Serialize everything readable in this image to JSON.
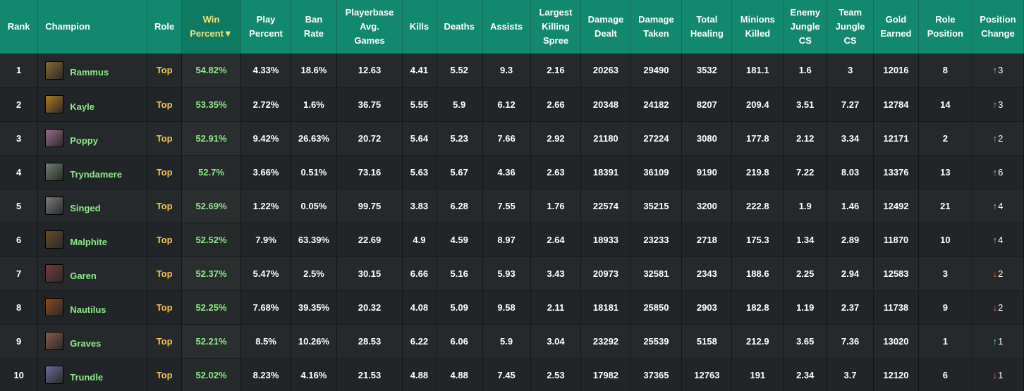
{
  "colors": {
    "header_bg": "#12896e",
    "sorted_header_text": "#f6e27a",
    "champion_text": "#8fe88a",
    "role_text": "#f6c453",
    "up_arrow": "#5fe07b",
    "down_arrow": "#ff6a3d"
  },
  "headers": [
    [
      "Rank"
    ],
    [
      "Champion"
    ],
    [
      "Role"
    ],
    [
      "Win",
      "Percent▼"
    ],
    [
      "Play",
      "Percent"
    ],
    [
      "Ban",
      "Rate"
    ],
    [
      "Playerbase",
      "Avg.",
      "Games"
    ],
    [
      "Kills"
    ],
    [
      "Deaths"
    ],
    [
      "Assists"
    ],
    [
      "Largest",
      "Killing",
      "Spree"
    ],
    [
      "Damage",
      "Dealt"
    ],
    [
      "Damage",
      "Taken"
    ],
    [
      "Total",
      "Healing"
    ],
    [
      "Minions",
      "Killed"
    ],
    [
      "Enemy",
      "Jungle",
      "CS"
    ],
    [
      "Team",
      "Jungle",
      "CS"
    ],
    [
      "Gold",
      "Earned"
    ],
    [
      "Role",
      "Position"
    ],
    [
      "Position",
      "Change"
    ]
  ],
  "rows": [
    {
      "rank": "1",
      "champion": "Rammus",
      "role": "Top",
      "win": "54.82%",
      "play": "4.33%",
      "ban": "18.6%",
      "games": "12.63",
      "kills": "4.41",
      "deaths": "5.52",
      "assists": "9.3",
      "spree": "2.16",
      "dealt": "20263",
      "taken": "29490",
      "healing": "3532",
      "minions": "181.1",
      "enemy_cs": "1.6",
      "team_cs": "3",
      "gold": "12016",
      "role_pos": "8",
      "change_dir": "up",
      "change": "3"
    },
    {
      "rank": "2",
      "champion": "Kayle",
      "role": "Top",
      "win": "53.35%",
      "play": "2.72%",
      "ban": "1.6%",
      "games": "36.75",
      "kills": "5.55",
      "deaths": "5.9",
      "assists": "6.12",
      "spree": "2.66",
      "dealt": "20348",
      "taken": "24182",
      "healing": "8207",
      "minions": "209.4",
      "enemy_cs": "3.51",
      "team_cs": "7.27",
      "gold": "12784",
      "role_pos": "14",
      "change_dir": "up",
      "change": "3"
    },
    {
      "rank": "3",
      "champion": "Poppy",
      "role": "Top",
      "win": "52.91%",
      "play": "9.42%",
      "ban": "26.63%",
      "games": "20.72",
      "kills": "5.64",
      "deaths": "5.23",
      "assists": "7.66",
      "spree": "2.92",
      "dealt": "21180",
      "taken": "27224",
      "healing": "3080",
      "minions": "177.8",
      "enemy_cs": "2.12",
      "team_cs": "3.34",
      "gold": "12171",
      "role_pos": "2",
      "change_dir": "up",
      "change": "2"
    },
    {
      "rank": "4",
      "champion": "Tryndamere",
      "role": "Top",
      "win": "52.7%",
      "play": "3.66%",
      "ban": "0.51%",
      "games": "73.16",
      "kills": "5.63",
      "deaths": "5.67",
      "assists": "4.36",
      "spree": "2.63",
      "dealt": "18391",
      "taken": "36109",
      "healing": "9190",
      "minions": "219.8",
      "enemy_cs": "7.22",
      "team_cs": "8.03",
      "gold": "13376",
      "role_pos": "13",
      "change_dir": "up",
      "change": "6"
    },
    {
      "rank": "5",
      "champion": "Singed",
      "role": "Top",
      "win": "52.69%",
      "play": "1.22%",
      "ban": "0.05%",
      "games": "99.75",
      "kills": "3.83",
      "deaths": "6.28",
      "assists": "7.55",
      "spree": "1.76",
      "dealt": "22574",
      "taken": "35215",
      "healing": "3200",
      "minions": "222.8",
      "enemy_cs": "1.9",
      "team_cs": "1.46",
      "gold": "12492",
      "role_pos": "21",
      "change_dir": "up",
      "change": "4"
    },
    {
      "rank": "6",
      "champion": "Malphite",
      "role": "Top",
      "win": "52.52%",
      "play": "7.9%",
      "ban": "63.39%",
      "games": "22.69",
      "kills": "4.9",
      "deaths": "4.59",
      "assists": "8.97",
      "spree": "2.64",
      "dealt": "18933",
      "taken": "23233",
      "healing": "2718",
      "minions": "175.3",
      "enemy_cs": "1.34",
      "team_cs": "2.89",
      "gold": "11870",
      "role_pos": "10",
      "change_dir": "up",
      "change": "4"
    },
    {
      "rank": "7",
      "champion": "Garen",
      "role": "Top",
      "win": "52.37%",
      "play": "5.47%",
      "ban": "2.5%",
      "games": "30.15",
      "kills": "6.66",
      "deaths": "5.16",
      "assists": "5.93",
      "spree": "3.43",
      "dealt": "20973",
      "taken": "32581",
      "healing": "2343",
      "minions": "188.6",
      "enemy_cs": "2.25",
      "team_cs": "2.94",
      "gold": "12583",
      "role_pos": "3",
      "change_dir": "down",
      "change": "2"
    },
    {
      "rank": "8",
      "champion": "Nautilus",
      "role": "Top",
      "win": "52.25%",
      "play": "7.68%",
      "ban": "39.35%",
      "games": "20.32",
      "kills": "4.08",
      "deaths": "5.09",
      "assists": "9.58",
      "spree": "2.11",
      "dealt": "18181",
      "taken": "25850",
      "healing": "2903",
      "minions": "182.8",
      "enemy_cs": "1.19",
      "team_cs": "2.37",
      "gold": "11738",
      "role_pos": "9",
      "change_dir": "down",
      "change": "2"
    },
    {
      "rank": "9",
      "champion": "Graves",
      "role": "Top",
      "win": "52.21%",
      "play": "8.5%",
      "ban": "10.26%",
      "games": "28.53",
      "kills": "6.22",
      "deaths": "6.06",
      "assists": "5.9",
      "spree": "3.04",
      "dealt": "23292",
      "taken": "25539",
      "healing": "5158",
      "minions": "212.9",
      "enemy_cs": "3.65",
      "team_cs": "7.36",
      "gold": "13020",
      "role_pos": "1",
      "change_dir": "up",
      "change": "1"
    },
    {
      "rank": "10",
      "champion": "Trundle",
      "role": "Top",
      "win": "52.02%",
      "play": "8.23%",
      "ban": "4.16%",
      "games": "21.53",
      "kills": "4.88",
      "deaths": "4.88",
      "assists": "7.45",
      "spree": "2.53",
      "dealt": "17982",
      "taken": "37365",
      "healing": "12763",
      "minions": "191",
      "enemy_cs": "2.34",
      "team_cs": "3.7",
      "gold": "12120",
      "role_pos": "6",
      "change_dir": "down",
      "change": "1"
    }
  ]
}
